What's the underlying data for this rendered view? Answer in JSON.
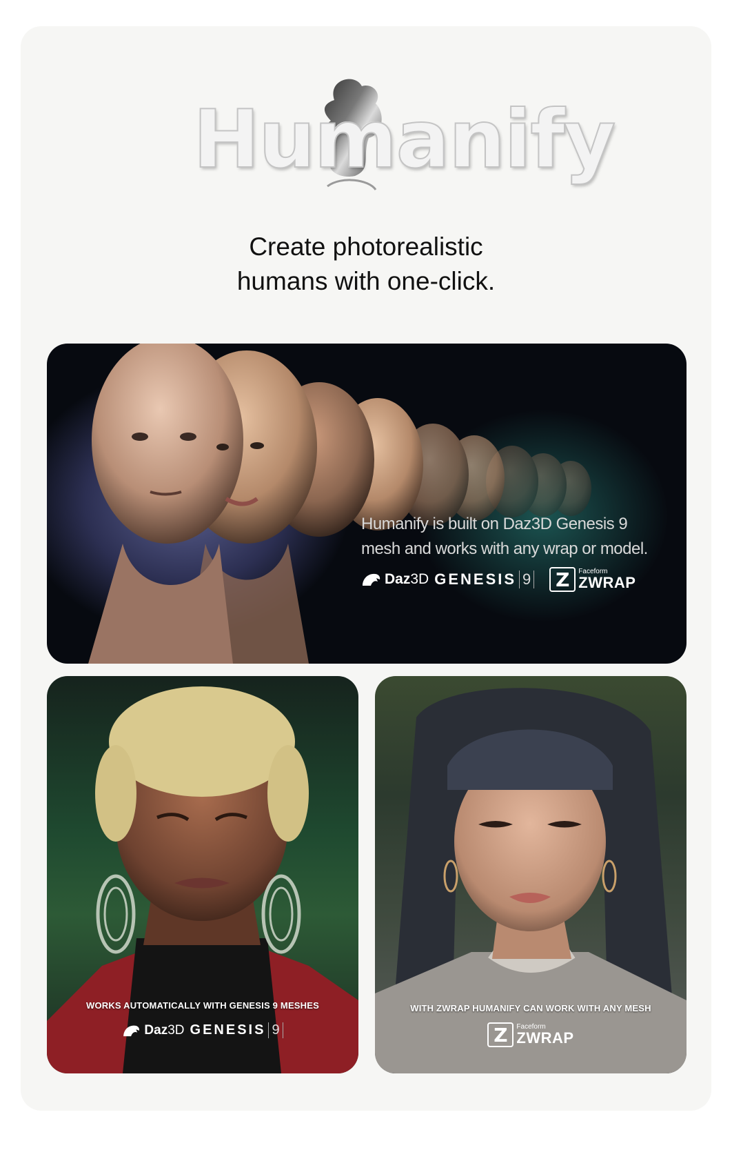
{
  "brand": {
    "logo_text": "Humanify"
  },
  "tagline": {
    "line1": "Create photorealistic",
    "line2": "humans with one-click."
  },
  "hero": {
    "line1": "Humanify is built on Daz3D Genesis 9",
    "line2": "mesh and works with any wrap or model.",
    "daz": {
      "name": "Daz",
      "suffix": "3D",
      "genesis": "GENESIS",
      "version": "9"
    },
    "zwrap": {
      "letter": "Z",
      "faceform": "Faceform",
      "name": "ZWRAP"
    }
  },
  "left_card": {
    "caption": "WORKS AUTOMATICALLY WITH GENESIS 9 MESHES",
    "daz": {
      "name": "Daz",
      "suffix": "3D",
      "genesis": "GENESIS",
      "version": "9"
    }
  },
  "right_card": {
    "caption": "WITH ZWRAP HUMANIFY CAN WORK WITH ANY MESH",
    "zwrap": {
      "letter": "Z",
      "faceform": "Faceform",
      "name": "ZWRAP"
    }
  },
  "colors": {
    "card_bg": "#f6f6f4",
    "hero_bg": "#070a10",
    "text": "#111111"
  },
  "icons": [
    "humanify-logo-blob",
    "daz-horse-icon",
    "zwrap-z-icon",
    "person-portrait",
    "face-row"
  ]
}
